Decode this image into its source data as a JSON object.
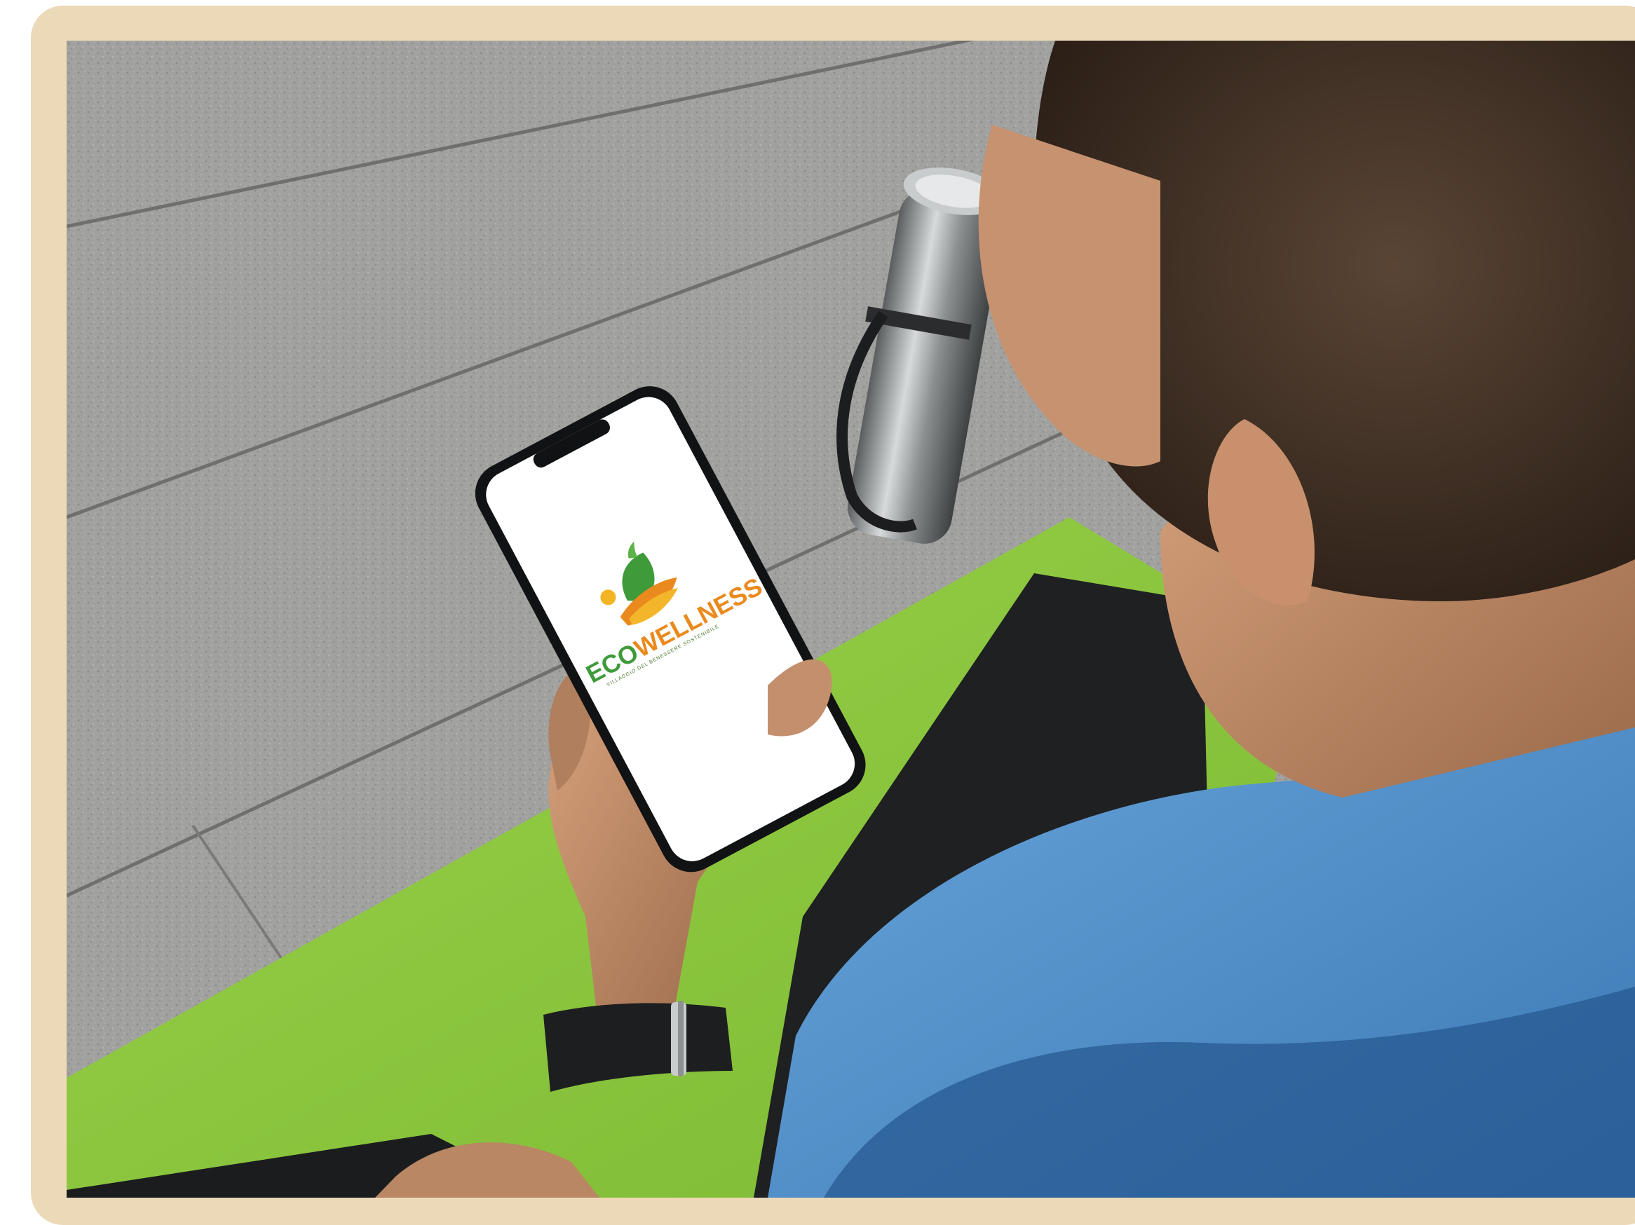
{
  "photo": {
    "subject": "person-holding-smartphone",
    "colors": {
      "frame": "#ecd9b8",
      "pavement": "#9c9c9a",
      "yoga_mat": "#8cc63f",
      "towel": "#4f8fcc",
      "logo_green": "#3f9b3a",
      "logo_orange": "#ea8a1e"
    }
  },
  "phone_screen": {
    "logo": {
      "word_part_1": "ECO",
      "word_part_2": "WELLNESS",
      "tagline": "VILLAGGIO DEL BENESSERE SOSTENIBILE"
    }
  }
}
